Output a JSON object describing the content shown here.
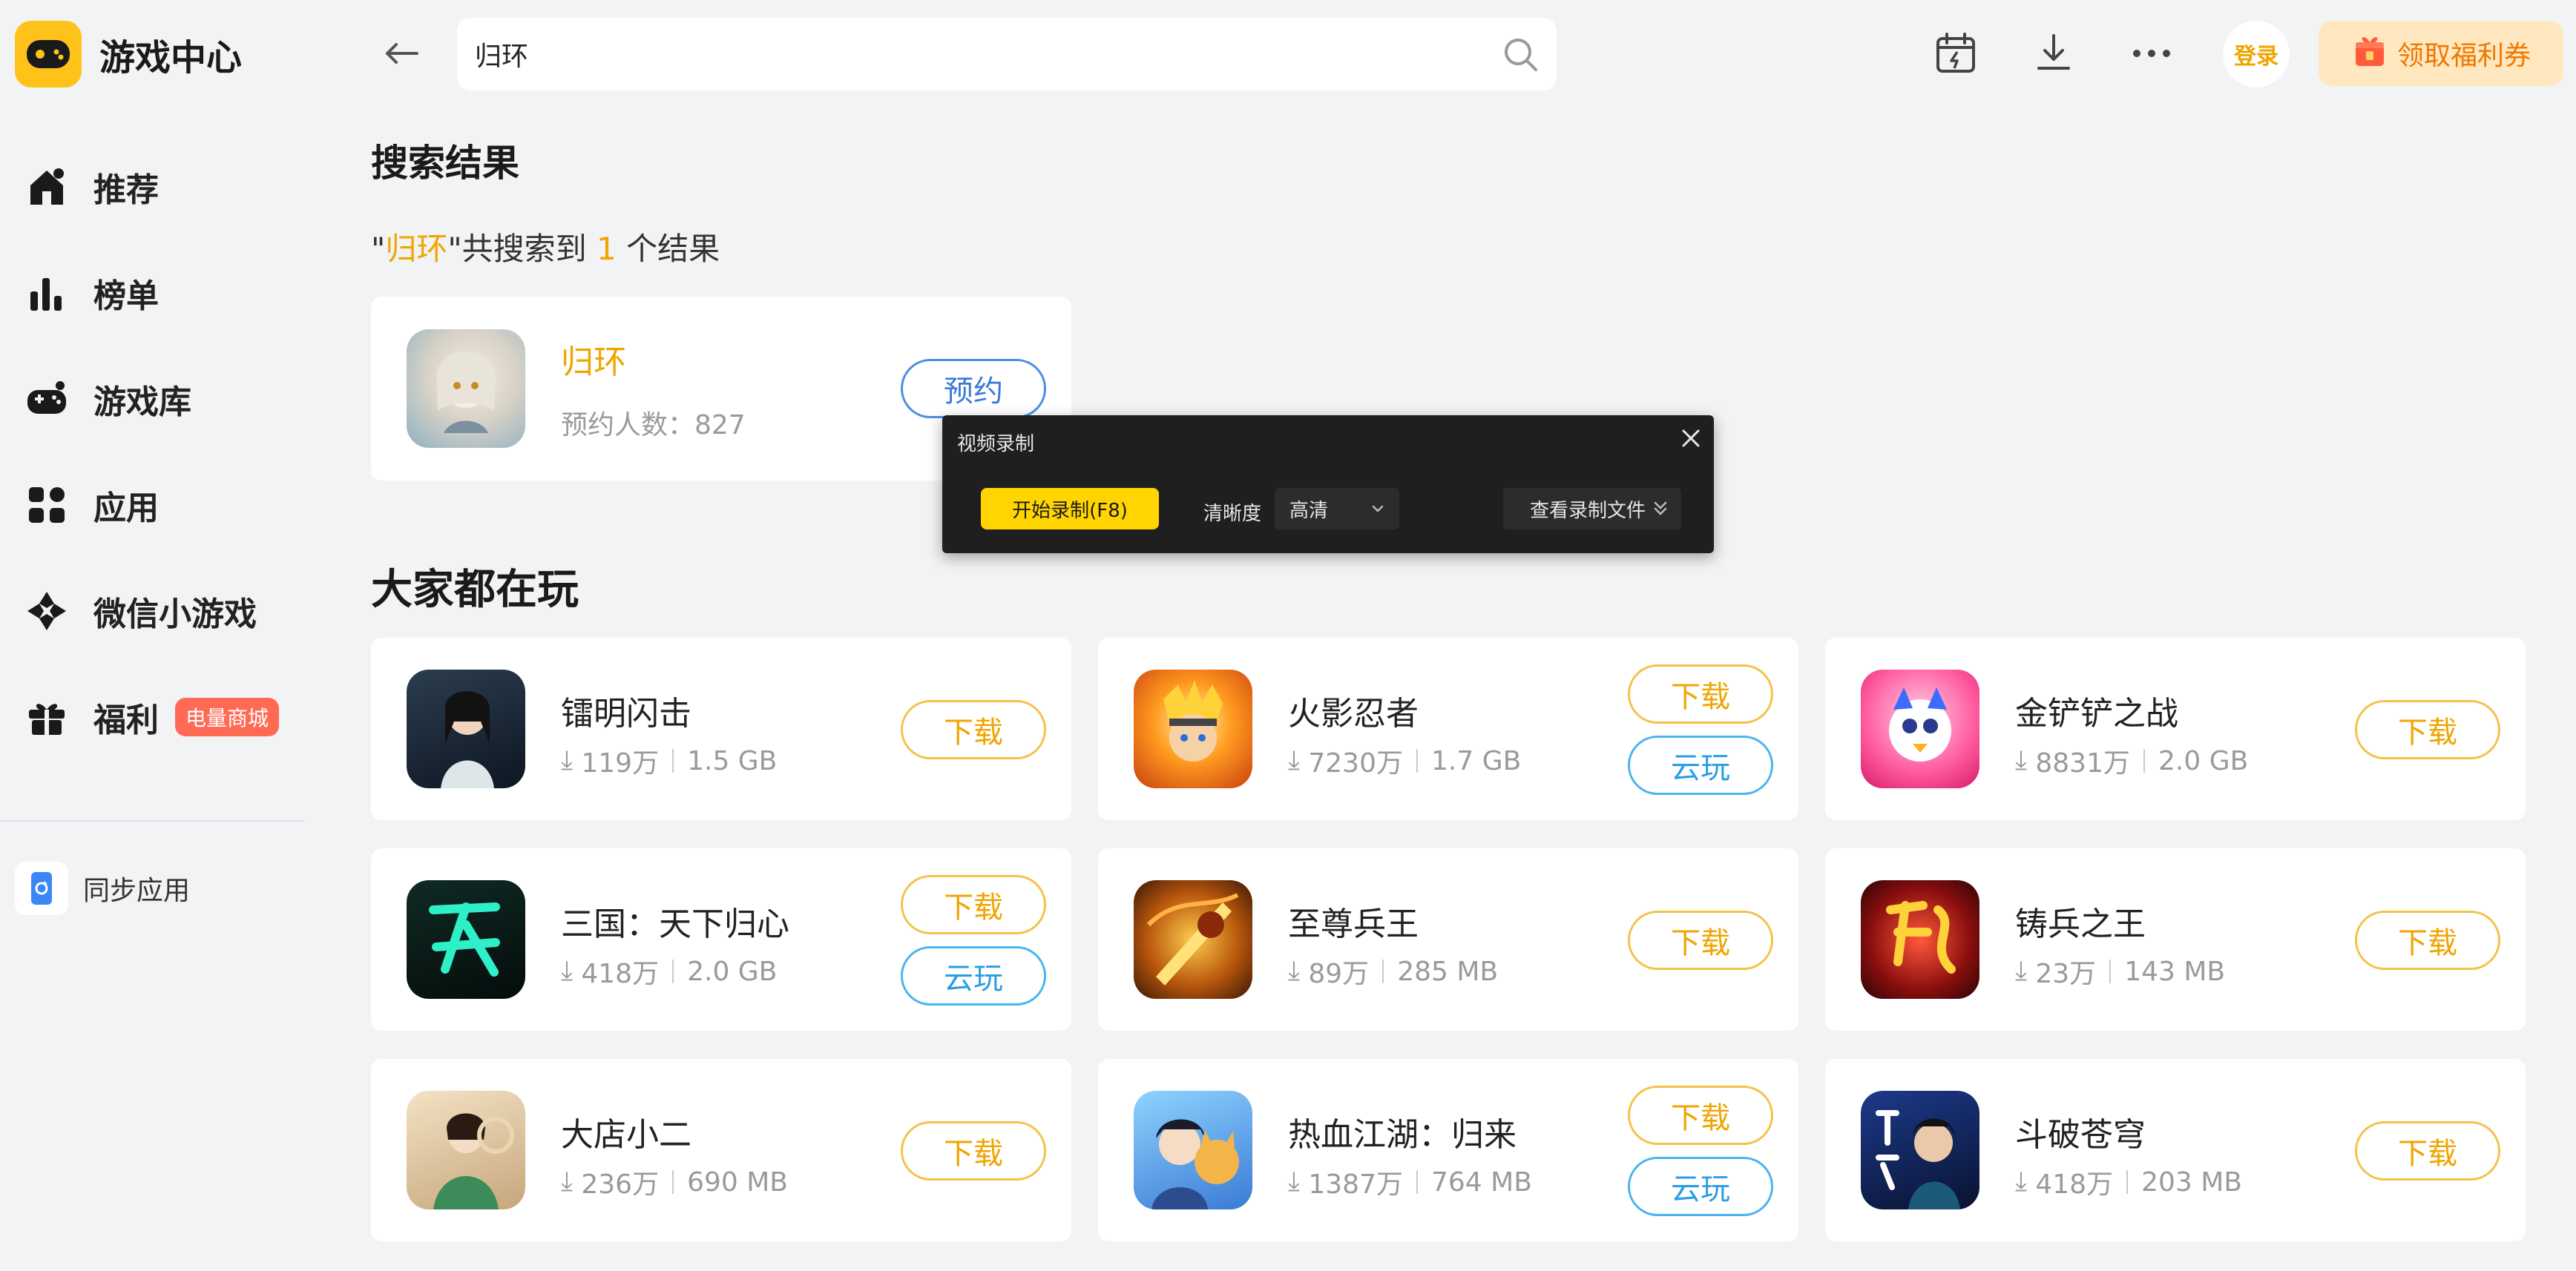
{
  "app": {
    "title": "游戏中心"
  },
  "sidebar": {
    "items": [
      {
        "label": "推荐",
        "icon": "home-icon"
      },
      {
        "label": "榜单",
        "icon": "chart-bars-icon"
      },
      {
        "label": "游戏库",
        "icon": "gamepad-icon"
      },
      {
        "label": "应用",
        "icon": "apps-grid-icon"
      },
      {
        "label": "微信小游戏",
        "icon": "wechat-minigame-icon"
      },
      {
        "label": "福利",
        "icon": "gift-icon",
        "badge": "电量商城"
      }
    ],
    "sync_label": "同步应用"
  },
  "search": {
    "value": "归环"
  },
  "header": {
    "login_label": "登录",
    "coupon_label": "领取福利券"
  },
  "results": {
    "heading": "搜索结果",
    "quote_open": "\"",
    "query": "归环",
    "quote_close_prefix": "\"共搜索到 ",
    "count": "1",
    "suffix": " 个结果",
    "item": {
      "name": "归环",
      "reservations_label": "预约人数：827",
      "button": "预约"
    }
  },
  "popular": {
    "heading": "大家都在玩",
    "games": [
      {
        "name": "镭明闪击",
        "downloads": "119万",
        "size": "1.5 GB",
        "download_label": "下载"
      },
      {
        "name": "火影忍者",
        "downloads": "7230万",
        "size": "1.7 GB",
        "download_label": "下载",
        "cloud_label": "云玩"
      },
      {
        "name": "金铲铲之战",
        "downloads": "8831万",
        "size": "2.0 GB",
        "download_label": "下载"
      },
      {
        "name": "三国：天下归心",
        "downloads": "418万",
        "size": "2.0 GB",
        "download_label": "下载",
        "cloud_label": "云玩"
      },
      {
        "name": "至尊兵王",
        "downloads": "89万",
        "size": "285 MB",
        "download_label": "下载"
      },
      {
        "name": "铸兵之王",
        "downloads": "23万",
        "size": "143 MB",
        "download_label": "下载"
      },
      {
        "name": "大店小二",
        "downloads": "236万",
        "size": "690 MB",
        "download_label": "下载"
      },
      {
        "name": "热血江湖：归来",
        "downloads": "1387万",
        "size": "764 MB",
        "download_label": "下载",
        "cloud_label": "云玩"
      },
      {
        "name": "斗破苍穹",
        "downloads": "418万",
        "size": "203 MB",
        "download_label": "下载"
      }
    ]
  },
  "recorder": {
    "title": "视频录制",
    "start_label": "开始录制(F8)",
    "quality_label": "清晰度",
    "quality_value": "高清",
    "files_label": "查看录制文件"
  },
  "colors": {
    "accent": "#f0a500",
    "cloud": "#2b9de3",
    "logo": "#ffc21a",
    "badge": "#ff6a55"
  }
}
